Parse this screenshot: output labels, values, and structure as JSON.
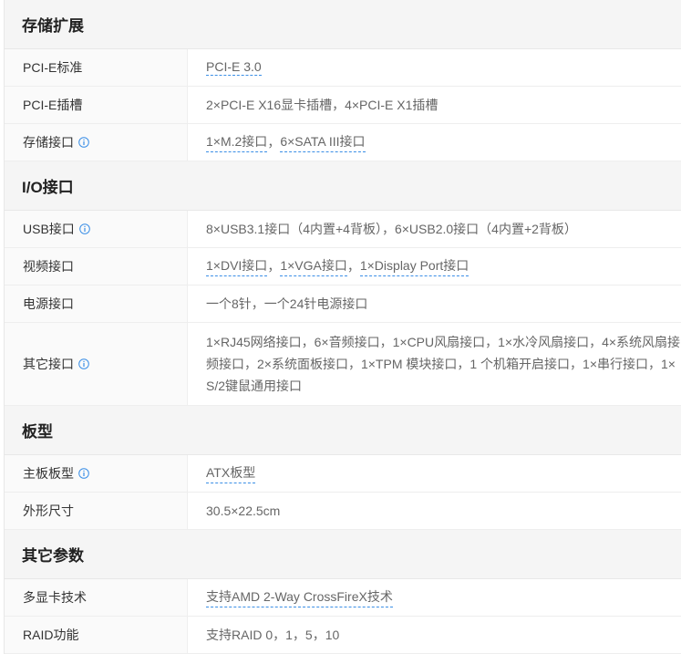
{
  "sections": [
    {
      "title": "存储扩展",
      "rows": [
        {
          "label": "PCI-E标准",
          "info": false,
          "values": [
            "PCI-E 3.0"
          ],
          "linked": [
            true
          ]
        },
        {
          "label": "PCI-E插槽",
          "info": false,
          "values": [
            "2×PCI-E X16显卡插槽，4×PCI-E X1插槽"
          ],
          "linked": [
            false
          ]
        },
        {
          "label": "存储接口",
          "info": true,
          "values": [
            "1×M.2接口",
            "6×SATA III接口"
          ],
          "linked": [
            true,
            true
          ]
        }
      ]
    },
    {
      "title": "I/O接口",
      "rows": [
        {
          "label": "USB接口",
          "info": true,
          "values": [
            "8×USB3.1接口（4内置+4背板），6×USB2.0接口（4内置+2背板）"
          ],
          "linked": [
            false
          ]
        },
        {
          "label": "视频接口",
          "info": false,
          "values": [
            "1×DVI接口",
            "1×VGA接口",
            "1×Display Port接口"
          ],
          "linked": [
            true,
            true,
            true
          ]
        },
        {
          "label": "电源接口",
          "info": false,
          "values": [
            "一个8针，一个24针电源接口"
          ],
          "linked": [
            false
          ]
        },
        {
          "label": "其它接口",
          "info": true,
          "lines": [
            "1×RJ45网络接口，6×音频接口，1×CPU风扇接口，1×水冷风扇接口，4×系统风扇接",
            "频接口，2×系统面板接口，1×TPM 模块接口，1 个机箱开启接口，1×串行接口，1×",
            "S/2键鼠通用接口"
          ]
        }
      ]
    },
    {
      "title": "板型",
      "rows": [
        {
          "label": "主板板型",
          "info": true,
          "values": [
            "ATX板型"
          ],
          "linked": [
            true
          ]
        },
        {
          "label": "外形尺寸",
          "info": false,
          "values": [
            "30.5×22.5cm"
          ],
          "linked": [
            false
          ]
        }
      ]
    },
    {
      "title": "其它参数",
      "rows": [
        {
          "label": "多显卡技术",
          "info": false,
          "values": [
            "支持AMD 2-Way CrossFireX技术"
          ],
          "linked": [
            true
          ]
        },
        {
          "label": "RAID功能",
          "info": false,
          "values": [
            "支持RAID 0，1，5，10"
          ],
          "linked": [
            false
          ]
        }
      ]
    }
  ],
  "separator": "，",
  "colors": {
    "section_bg": "#f5f5f5",
    "label_bg": "#fafafa",
    "link_underline": "#3a8ee6",
    "info_icon": "#3a8ee6"
  },
  "icons": {
    "info": "info-circle-icon"
  }
}
